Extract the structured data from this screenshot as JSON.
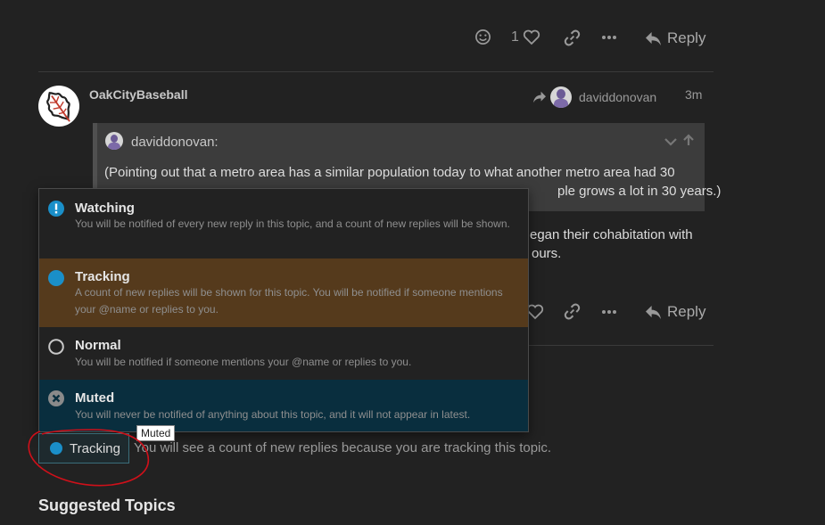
{
  "top_controls": {
    "like_count": "1",
    "reply_label": "Reply"
  },
  "post": {
    "username": "OakCityBaseball",
    "reply_to_user": "daviddonovan",
    "time": "3m",
    "quote": {
      "author": "daviddonovan:",
      "text_line1": "(Pointing out that a metro area has a similar population today to what another metro area had 30",
      "text_line2_left": "",
      "text_line2_right": "ple grows a lot in 30 years.)"
    },
    "body_line1": "egan their cohabitation with",
    "body_line2": "ours.",
    "reply_label": "Reply"
  },
  "notification_menu": {
    "items": [
      {
        "title": "Watching",
        "description": "You will be notified of every new reply in this topic, and a count of new replies will be shown.",
        "icon": "exclamation-circle-icon",
        "bg": "#222222"
      },
      {
        "title": "Tracking",
        "description": "A count of new replies will be shown for this topic. You will be notified if someone mentions your @name or replies to you.",
        "icon": "filled-circle-icon",
        "bg": "#553a1c"
      },
      {
        "title": "Normal",
        "description": "You will be notified if someone mentions your @name or replies to you.",
        "icon": "empty-circle-icon",
        "bg": "#222222"
      },
      {
        "title": "Muted",
        "description": "You will never be notified of anything about this topic, and it will not appear in latest.",
        "icon": "x-circle-icon",
        "bg": "#092e3e"
      }
    ]
  },
  "tooltip": "Muted",
  "tracking_button": {
    "label": "Tracking",
    "status_text": "You will see a count of new replies because you are tracking this topic."
  },
  "suggested_heading": "Suggested Topics",
  "colors": {
    "accent": "#1a8fc9",
    "annotation": "#d0101a",
    "tracking_bg": "#553a1c",
    "muted_bg": "#092e3e"
  }
}
